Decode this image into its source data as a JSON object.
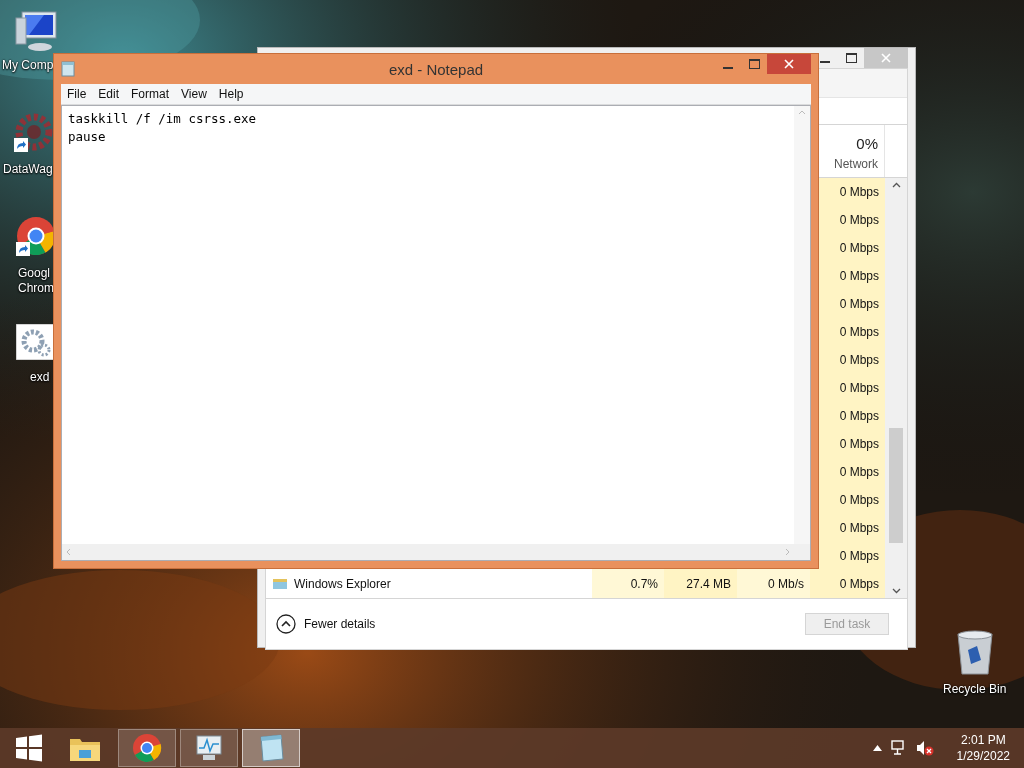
{
  "desktop_icons": [
    {
      "kind": "computer",
      "lines": [
        "My Comp"
      ],
      "shortcut": false
    },
    {
      "kind": "app-shortcut",
      "lines": [
        "DataWag"
      ],
      "shortcut": true
    },
    {
      "kind": "browser",
      "lines": [
        "Googl",
        "Chrom"
      ],
      "shortcut": true
    },
    {
      "kind": "batch-file",
      "lines": [
        "exd"
      ],
      "shortcut": false
    }
  ],
  "recycle_bin": {
    "label": "Recycle Bin"
  },
  "task_manager": {
    "network_header": {
      "percent": "0%",
      "label": "Network"
    },
    "rows": [
      {
        "network": "0 Mbps"
      },
      {
        "network": "0 Mbps"
      },
      {
        "network": "0 Mbps"
      },
      {
        "network": "0 Mbps"
      },
      {
        "network": "0 Mbps"
      },
      {
        "network": "0 Mbps"
      },
      {
        "network": "0 Mbps"
      },
      {
        "network": "0 Mbps"
      },
      {
        "network": "0 Mbps"
      },
      {
        "network": "0 Mbps"
      },
      {
        "network": "0 Mbps"
      },
      {
        "network": "0 Mbps"
      },
      {
        "network": "0 Mbps"
      },
      {
        "network": "0 Mbps"
      },
      {
        "name": "Windows Explorer",
        "cpu": "0.7%",
        "memory": "27.4 MB",
        "disk": "0 Mb/s",
        "network": "0 Mbps"
      }
    ],
    "fewer_details": "Fewer details",
    "end_task": {
      "label": "End task",
      "disabled": true
    }
  },
  "notepad": {
    "title": "exd - Notepad",
    "menu": [
      "File",
      "Edit",
      "Format",
      "View",
      "Help"
    ],
    "lines": [
      "taskkill /f /im csrss.exe",
      "pause"
    ]
  },
  "taskbar": {
    "items": [
      {
        "kind": "folder",
        "running": false,
        "selected": false
      },
      {
        "kind": "browser",
        "running": true,
        "selected": false
      },
      {
        "kind": "monitor",
        "running": true,
        "selected": false
      },
      {
        "kind": "notepad",
        "running": true,
        "selected": true
      }
    ],
    "volume_muted": true,
    "time": "2:01 PM",
    "date": "1/29/2022"
  }
}
